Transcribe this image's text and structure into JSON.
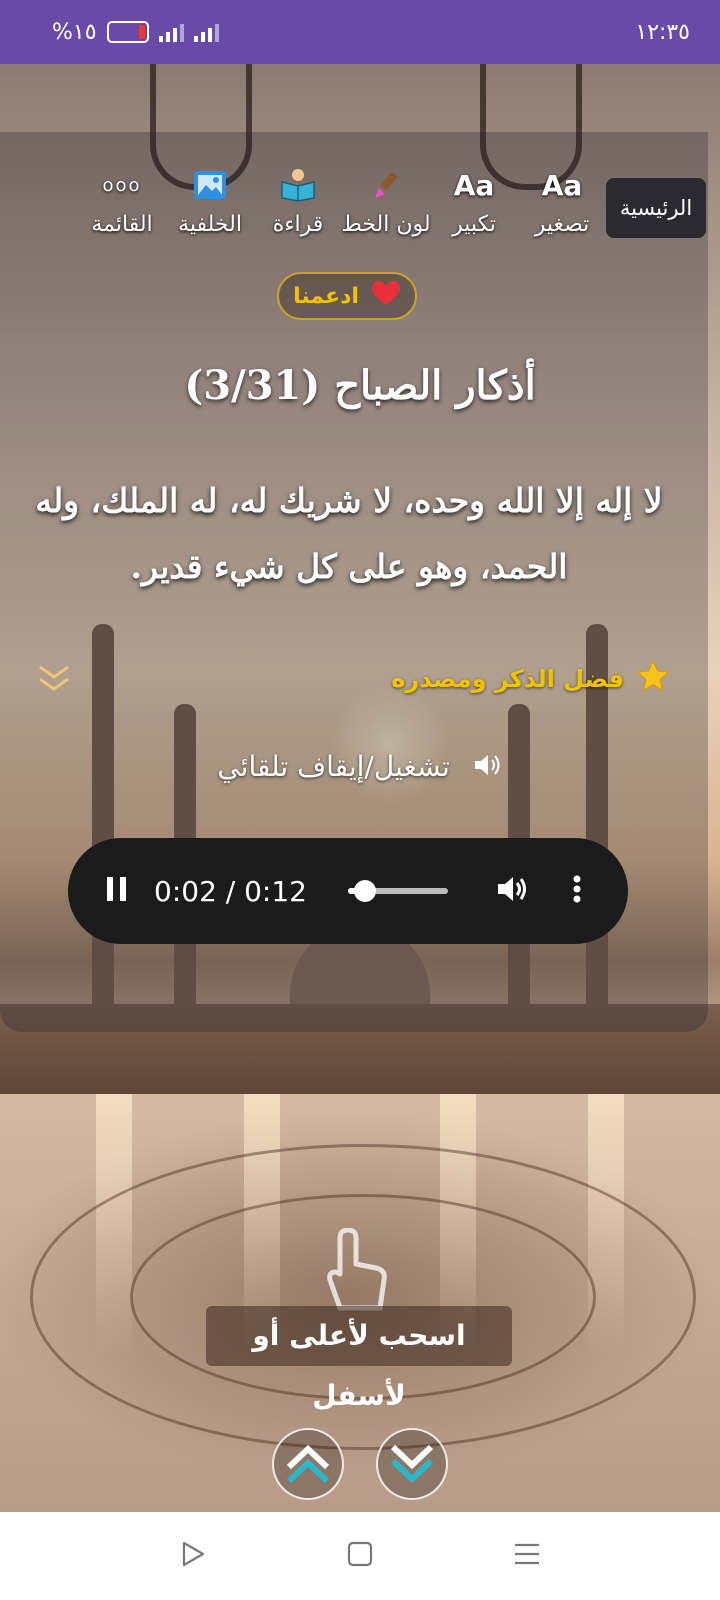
{
  "status_bar": {
    "time": "١٢:٣٥",
    "battery": "%١٥"
  },
  "toolbar": {
    "home_label": "الرئيسية",
    "items": [
      {
        "icon": "Aa",
        "label": "تصغير"
      },
      {
        "icon": "Aa",
        "label": "تكبير"
      },
      {
        "icon": "paint-brush-icon",
        "label": "لون الخط"
      },
      {
        "icon": "reading-book-icon",
        "label": "قراءة"
      },
      {
        "icon": "image-icon",
        "label": "الخلفية"
      },
      {
        "icon": "ooo",
        "label": "القائمة"
      }
    ]
  },
  "support_button": {
    "label": "ادعمنا",
    "icon": "heart-icon"
  },
  "dhikr": {
    "title": "أذكار الصباح (3/31)",
    "text": "لا إله إلا الله وحده، لا شريك له، له الملك، وله الحمد، وهو على كل شيء قدير.",
    "virtue_label": "فضل الذكر ومصدره"
  },
  "autoplay_label": "تشغيل/إيقاف تلقائي",
  "audio_player": {
    "time_display": "0:02 / 0:12",
    "progress": 0.17
  },
  "swipe_hint": "اسحب لأعلى أو لأسفل",
  "colors": {
    "status_bar": "#6a4aa8",
    "accent_gold": "#f2c200",
    "player_bg": "#1b1b1b",
    "nav_teal": "#2bb7c9"
  }
}
